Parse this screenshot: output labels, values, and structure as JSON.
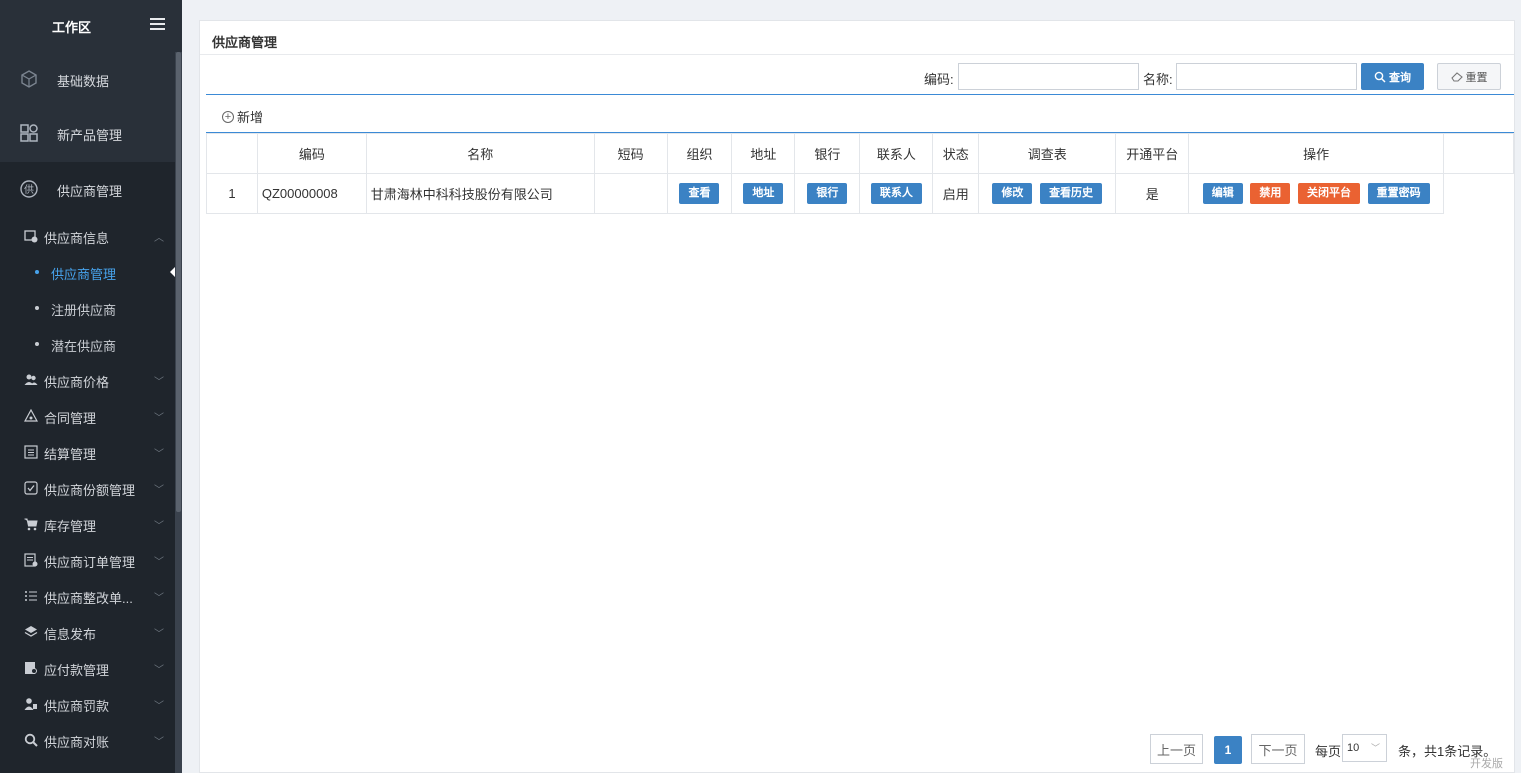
{
  "sidebar": {
    "workspace_title": "工作区",
    "top_items": [
      {
        "label": "基础数据",
        "icon": "cube-icon"
      },
      {
        "label": "新产品管理",
        "icon": "grid-icon"
      },
      {
        "label": "供应商管理",
        "icon": "supplier-icon"
      }
    ],
    "groups": [
      {
        "label": "供应商信息",
        "icon": "supplier-info-icon",
        "expanded": true,
        "children": [
          {
            "label": "供应商管理",
            "active": true
          },
          {
            "label": "注册供应商"
          },
          {
            "label": "潜在供应商"
          }
        ]
      },
      {
        "label": "供应商价格",
        "icon": "users-icon"
      },
      {
        "label": "合同管理",
        "icon": "contract-icon"
      },
      {
        "label": "结算管理",
        "icon": "list-icon"
      },
      {
        "label": "供应商份额管理",
        "icon": "check-icon"
      },
      {
        "label": "库存管理",
        "icon": "cart-icon"
      },
      {
        "label": "供应商订单管理",
        "icon": "order-icon"
      },
      {
        "label": "供应商整改单...",
        "icon": "bullet-list-icon"
      },
      {
        "label": "信息发布",
        "icon": "layers-icon"
      },
      {
        "label": "应付款管理",
        "icon": "payable-icon"
      },
      {
        "label": "供应商罚款",
        "icon": "penalty-icon"
      },
      {
        "label": "供应商对账",
        "icon": "search-icon"
      }
    ]
  },
  "panel": {
    "title": "供应商管理",
    "search": {
      "code_label": "编码:",
      "code_value": "",
      "name_label": "名称:",
      "name_value": "",
      "query_label": "查询",
      "reset_label": "重置"
    },
    "add_label": "新增",
    "table": {
      "columns": [
        "",
        "编码",
        "名称",
        "短码",
        "组织",
        "地址",
        "银行",
        "联系人",
        "状态",
        "调查表",
        "开通平台",
        "操作",
        ""
      ],
      "rows": [
        {
          "index": "1",
          "code": "QZ00000008",
          "name": "甘肃海林中科科技股份有限公司",
          "short_code": "",
          "org_btn": "查看",
          "addr_btn": "地址",
          "bank_btn": "银行",
          "contact_btn": "联系人",
          "status": "启用",
          "survey_btns": [
            "修改",
            "查看历史"
          ],
          "platform": "是",
          "op_btns": [
            "编辑",
            "禁用",
            "关闭平台",
            "重置密码"
          ]
        }
      ]
    },
    "pager": {
      "prev": "上一页",
      "current": "1",
      "next": "下一页",
      "per_page_label": "每页",
      "per_page_value": "10",
      "summary": "条，共1条记录。"
    },
    "edition": "开发版"
  },
  "colors": {
    "sidebar_bg": "#293039",
    "primary": "#3b82c4",
    "danger": "#ea6232",
    "active_link": "#47a3ec"
  }
}
